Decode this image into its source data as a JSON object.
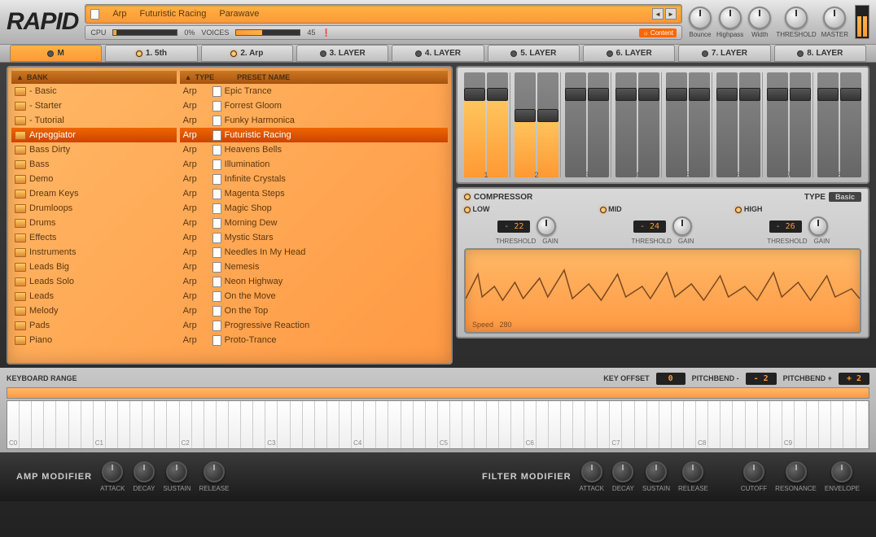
{
  "logo": "RAPID",
  "preset": {
    "category": "Arp",
    "name": "Futuristic Racing",
    "author": "Parawave"
  },
  "status": {
    "cpu_label": "CPU",
    "cpu_pct": "0%",
    "voices_label": "VOICES",
    "voices": "45",
    "content": "Content"
  },
  "top_knobs": [
    {
      "name": "bounce",
      "label": "Bounce"
    },
    {
      "name": "highpass",
      "label": "Highpass"
    },
    {
      "name": "width",
      "label": "Width"
    },
    {
      "name": "threshold",
      "label": "THRESHOLD"
    },
    {
      "name": "master",
      "label": "MASTER"
    }
  ],
  "layers": [
    {
      "label": "M",
      "on": false,
      "active": true
    },
    {
      "label": "1. 5th",
      "on": true
    },
    {
      "label": "2. Arp",
      "on": true
    },
    {
      "label": "3. LAYER",
      "on": false
    },
    {
      "label": "4. LAYER",
      "on": false
    },
    {
      "label": "5. LAYER",
      "on": false
    },
    {
      "label": "6. LAYER",
      "on": false
    },
    {
      "label": "7. LAYER",
      "on": false
    },
    {
      "label": "8. LAYER",
      "on": false
    }
  ],
  "browser": {
    "bank_header": "BANK",
    "type_header": "TYPE",
    "preset_header": "PRESET NAME",
    "banks": [
      "- Basic",
      "- Starter",
      "- Tutorial",
      "Arpeggiator",
      "Bass Dirty",
      "Bass",
      "Demo",
      "Dream Keys",
      "Drumloops",
      "Drums",
      "Effects",
      "Instruments",
      "Leads Big",
      "Leads Solo",
      "Leads",
      "Melody",
      "Pads",
      "Piano"
    ],
    "bank_selected": 3,
    "presets": [
      "Epic Trance",
      "Forrest Gloom",
      "Funky Harmonica",
      "Futuristic Racing",
      "Heavens Bells",
      "Illumination",
      "Infinite Crystals",
      "Magenta Steps",
      "Magic Shop",
      "Morning Dew",
      "Mystic Stars",
      "Needles In My Head",
      "Nemesis",
      "Neon Highway",
      "On the Move",
      "On the Top",
      "Progressive Reaction",
      "Proto-Trance"
    ],
    "preset_selected": 3,
    "preset_type": "Arp"
  },
  "mixer_channels": [
    "1",
    "2",
    "3",
    "4",
    "5",
    "6",
    "7",
    "8"
  ],
  "compressor": {
    "title": "COMPRESSOR",
    "type_label": "TYPE",
    "type": "Basic",
    "bands": [
      {
        "name": "LOW",
        "threshold": "- 22"
      },
      {
        "name": "MID",
        "threshold": "- 24"
      },
      {
        "name": "HIGH",
        "threshold": "- 26"
      }
    ],
    "sub_labels": [
      "THRESHOLD",
      "GAIN"
    ],
    "speed_label": "Speed",
    "speed": "280"
  },
  "keyboard": {
    "title": "KEYBOARD RANGE",
    "key_offset_label": "KEY OFFSET",
    "key_offset": "0",
    "pb_minus_label": "PITCHBEND -",
    "pb_minus": "- 2",
    "pb_plus_label": "PITCHBEND +",
    "pb_plus": "+ 2",
    "octaves": [
      "C0",
      "C1",
      "C2",
      "C3",
      "C4",
      "C5",
      "C6",
      "C7",
      "C8",
      "C9"
    ]
  },
  "modifiers": {
    "amp_title": "AMP MODIFIER",
    "filter_title": "FILTER MODIFIER",
    "amp": [
      "ATTACK",
      "DECAY",
      "SUSTAIN",
      "RELEASE"
    ],
    "filter": [
      "ATTACK",
      "DECAY",
      "SUSTAIN",
      "RELEASE",
      "CUTOFF",
      "RESONANCE",
      "ENVELOPE"
    ]
  }
}
